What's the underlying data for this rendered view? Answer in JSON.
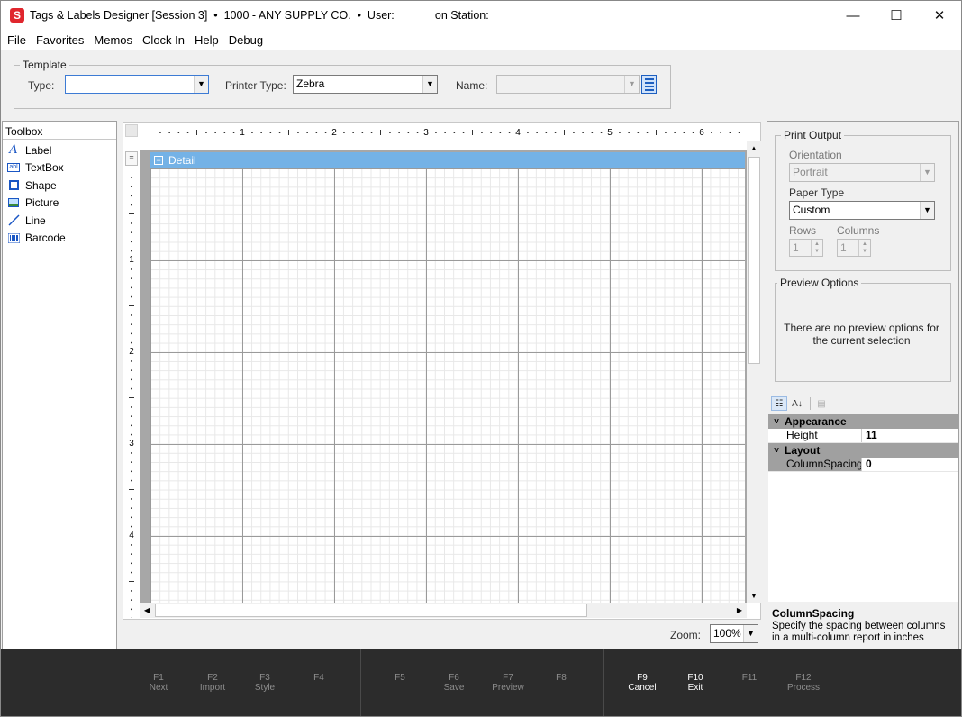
{
  "window": {
    "title": "Tags & Labels Designer [Session 3]  •  1000 - ANY SUPPLY CO.  •  User:             on Station:",
    "app_icon_letter": "S",
    "controls": {
      "minimize": "—",
      "maximize": "☐",
      "close": "✕"
    }
  },
  "menu": [
    "File",
    "Favorites",
    "Memos",
    "Clock In",
    "Help",
    "Debug"
  ],
  "template": {
    "legend": "Template",
    "type_label": "Type:",
    "type_value": "",
    "printer_type_label": "Printer Type:",
    "printer_type_value": "Zebra",
    "name_label": "Name:",
    "name_value": ""
  },
  "toolbox": {
    "header": "Toolbox",
    "items": [
      {
        "label": "Label",
        "icon": "label-icon"
      },
      {
        "label": "TextBox",
        "icon": "textbox-icon"
      },
      {
        "label": "Shape",
        "icon": "shape-icon"
      },
      {
        "label": "Picture",
        "icon": "picture-icon"
      },
      {
        "label": "Line",
        "icon": "line-icon"
      },
      {
        "label": "Barcode",
        "icon": "barcode-icon"
      }
    ]
  },
  "designer": {
    "ruler_top_numbers": [
      "1",
      "2",
      "3",
      "4",
      "5",
      "6"
    ],
    "ruler_left_numbers": [
      "1",
      "2",
      "3",
      "4"
    ],
    "detail_band_label": "Detail",
    "zoom_label": "Zoom:",
    "zoom_value": "100%"
  },
  "print_output": {
    "legend": "Print Output",
    "orientation_label": "Orientation",
    "orientation_value": "Portrait",
    "paper_type_label": "Paper Type",
    "paper_type_value": "Custom",
    "rows_label": "Rows",
    "rows_value": "1",
    "columns_label": "Columns",
    "columns_value": "1"
  },
  "preview_options": {
    "legend": "Preview Options",
    "message": "There are no preview options for the current selection"
  },
  "properties": {
    "categories": [
      {
        "name": "Appearance",
        "props": [
          {
            "name": "Height",
            "value": "11"
          }
        ]
      },
      {
        "name": "Layout",
        "props": [
          {
            "name": "ColumnSpacing",
            "value": "0"
          }
        ]
      }
    ],
    "help_title": "ColumnSpacing",
    "help_text": "Specify the spacing between columns in a multi-column report in inches"
  },
  "fkeys": [
    {
      "key": "F1",
      "label": "Next",
      "active": false
    },
    {
      "key": "F2",
      "label": "Import",
      "active": false
    },
    {
      "key": "F3",
      "label": "Style",
      "active": false
    },
    {
      "key": "F4",
      "label": "",
      "active": false
    },
    {
      "key": "F5",
      "label": "",
      "active": false
    },
    {
      "key": "F6",
      "label": "Save",
      "active": false
    },
    {
      "key": "F7",
      "label": "Preview",
      "active": false
    },
    {
      "key": "F8",
      "label": "",
      "active": false
    },
    {
      "key": "F9",
      "label": "Cancel",
      "active": true
    },
    {
      "key": "F10",
      "label": "Exit",
      "active": true
    },
    {
      "key": "F11",
      "label": "",
      "active": false
    },
    {
      "key": "F12",
      "label": "Process",
      "active": false
    }
  ],
  "colors": {
    "band": "#74b2e6",
    "accent_red": "#e0262d",
    "fkey_bar": "#2c2c2c"
  }
}
